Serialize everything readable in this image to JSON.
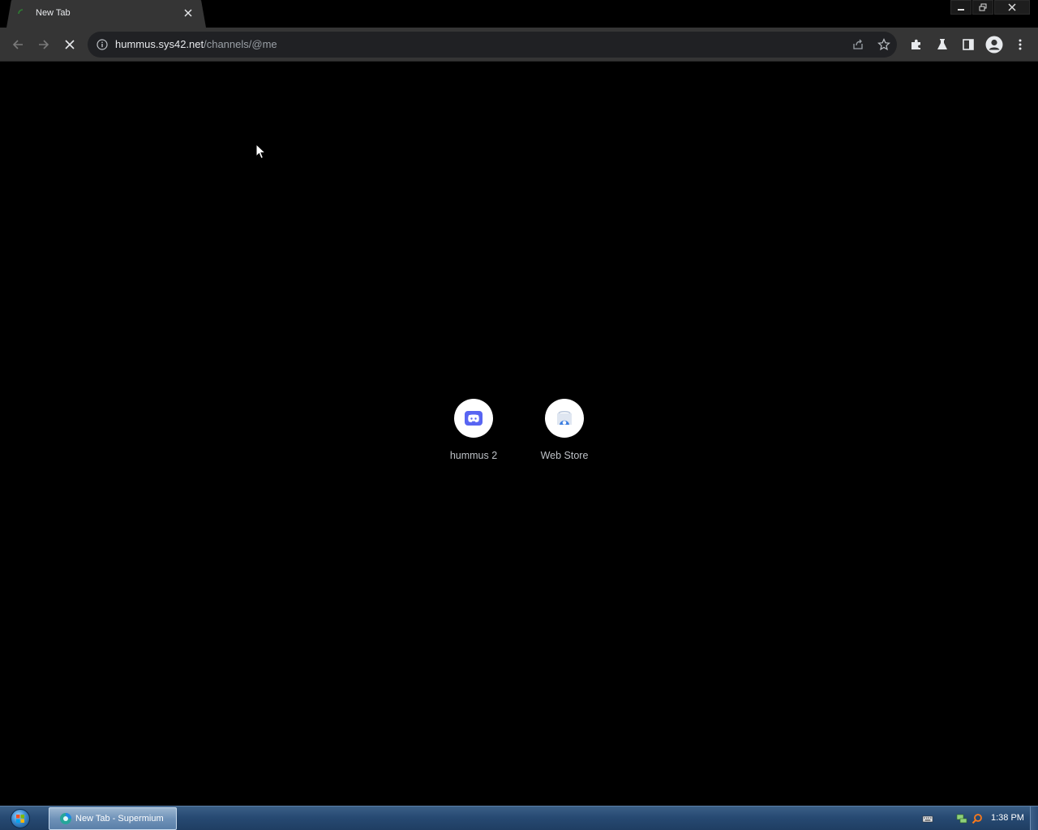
{
  "browser": {
    "tab": {
      "title": "New Tab"
    },
    "address_bar": {
      "host": "hummus.sys42.net",
      "path": "/channels/@me"
    }
  },
  "shortcuts": [
    {
      "label": "hummus 2",
      "icon": "discord-icon"
    },
    {
      "label": "Web Store",
      "icon": "web-store-icon"
    }
  ],
  "taskbar": {
    "active_window": "New Tab - Supermium",
    "clock": "1:38 PM"
  },
  "colors": {
    "page_background": "#000000",
    "toolbar": "#353535",
    "omnibox": "#202124",
    "discord_blurple": "#5865f2",
    "taskbar": "#274a73"
  }
}
